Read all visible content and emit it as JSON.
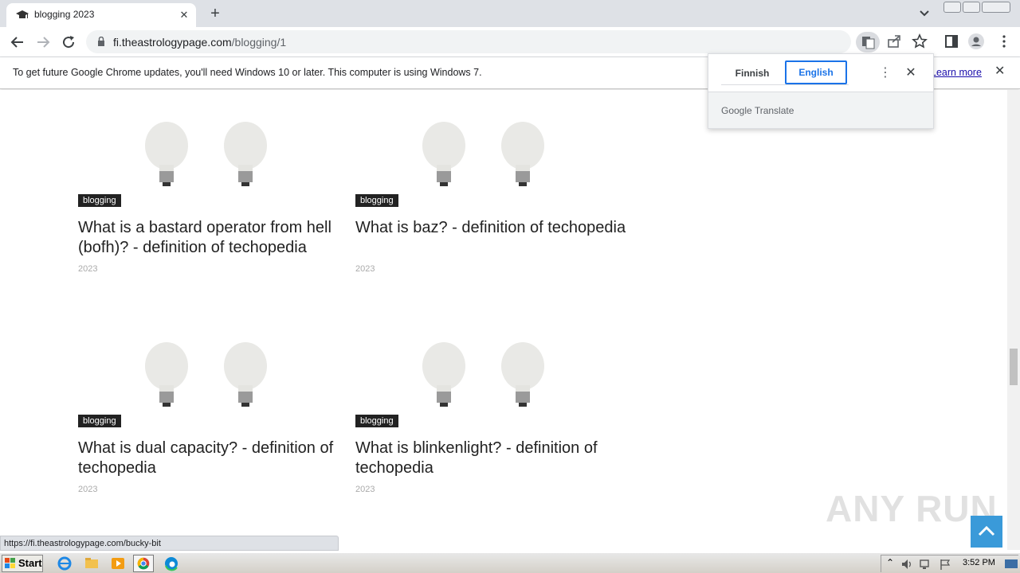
{
  "browser": {
    "tab": {
      "title": "blogging 2023"
    },
    "address": {
      "host": "fi.theastrologypage.com",
      "path": "/blogging/1"
    }
  },
  "infobar": {
    "message": "To get future Google Chrome updates, you'll need Windows 10 or later. This computer is using Windows 7.",
    "link": "Learn more"
  },
  "translate": {
    "source_lang": "Finnish",
    "target_lang": "English",
    "brand": "Google Translate"
  },
  "articles": [
    {
      "tag": "blogging",
      "title": "What is a bastard operator from hell (bofh)? - definition of techopedia",
      "year": "2023"
    },
    {
      "tag": "blogging",
      "title": "What is baz? - definition of techopedia",
      "year": "2023"
    },
    {
      "tag": "blogging",
      "title": "What is dual capacity? - definition of techopedia",
      "year": "2023"
    },
    {
      "tag": "blogging",
      "title": "What is blinkenlight? - definition of techopedia",
      "year": "2023"
    }
  ],
  "status_bar": {
    "url": "https://fi.theastrologypage.com/bucky-bit"
  },
  "watermark": "ANY RUN",
  "taskbar": {
    "start_label": "Start",
    "clock": "3:52 PM"
  },
  "colors": {
    "accent_blue": "#1a73e8",
    "tag_bg": "#222222",
    "scrolltop_bg": "#3a9ad9"
  }
}
